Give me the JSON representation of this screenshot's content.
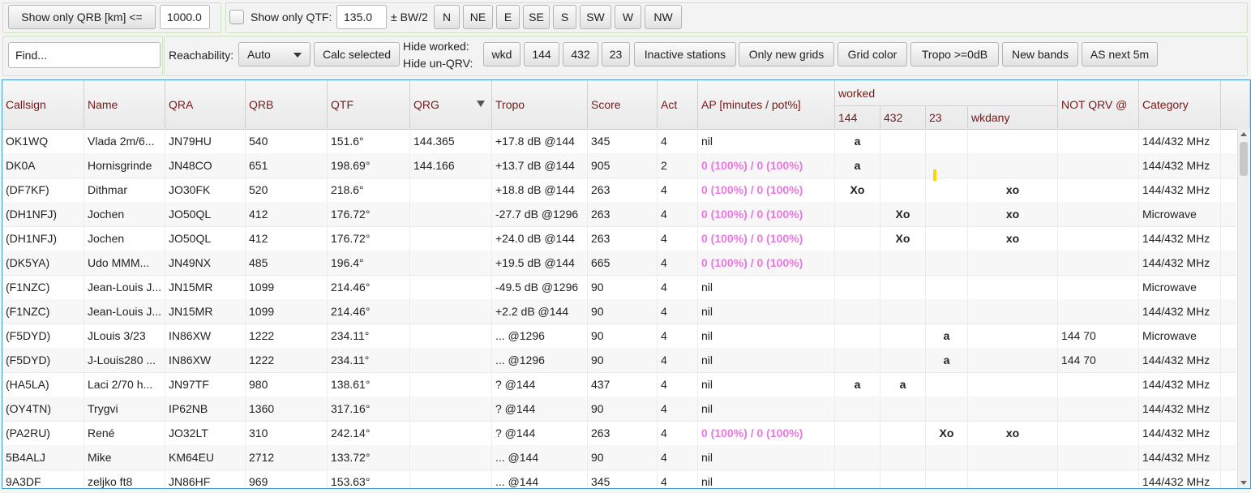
{
  "toolbar": {
    "qrb_button": "Show only QRB [km] <=",
    "qrb_value": "1000.0",
    "qtf_label": "Show only QTF:",
    "qtf_value": "135.0",
    "bw_label": "± BW/2",
    "directions": [
      "N",
      "NE",
      "E",
      "SE",
      "S",
      "SW",
      "W",
      "NW"
    ],
    "find_placeholder": "Find...",
    "reachability_label": "Reachability:",
    "reachability_value": "Auto",
    "calc_button": "Calc selected",
    "hide_worked": "Hide worked:",
    "hide_unqrv": "Hide un-QRV:",
    "filter_buttons": [
      "wkd",
      "144",
      "432",
      "23",
      "Inactive stations",
      "Only new grids",
      "Grid color",
      "Tropo >=0dB",
      "New bands",
      "AS next 5m"
    ]
  },
  "table": {
    "headers": {
      "callsign": "Callsign",
      "name": "Name",
      "qra": "QRA",
      "qrb": "QRB",
      "qtf": "QTF",
      "qrg": "QRG",
      "tropo": "Tropo",
      "score": "Score",
      "act": "Act",
      "ap": "AP [minutes / pot%]",
      "worked": "worked",
      "w144": "144",
      "w432": "432",
      "w23": "23",
      "wkdany": "wkdany",
      "notqrv": "NOT QRV @",
      "category": "Category"
    },
    "rows": [
      {
        "callsign": "OK1WQ",
        "name": "Vlada 2m/6...",
        "qra": "JN79HU",
        "qrb": "540",
        "qtf": "151.6°",
        "qrg": "144.365",
        "tropo": "+17.8 dB @144",
        "score": "345",
        "act": "4",
        "ap": "nil",
        "w144": "a",
        "w432": "",
        "w23": "",
        "wkdany": "",
        "notqrv": "",
        "category": "144/432 MHz"
      },
      {
        "callsign": "DK0A",
        "name": "Hornisgrinde",
        "qra": "JN48CO",
        "qrb": "651",
        "qtf": "198.69°",
        "qrg": "144.166",
        "tropo": "+13.7 dB @144",
        "score": "905",
        "act": "2",
        "ap": "0 (100%) / 0 (100%)",
        "w144": "a",
        "w432": "",
        "w23": "",
        "wkdany": "",
        "notqrv": "",
        "category": "144/432 MHz"
      },
      {
        "callsign": "(DF7KF)",
        "name": "Dithmar",
        "qra": "JO30FK",
        "qrb": "520",
        "qtf": "218.6°",
        "qrg": "",
        "tropo": "+18.8 dB @144",
        "score": "263",
        "act": "4",
        "ap": "0 (100%) / 0 (100%)",
        "w144": "Xo",
        "w432": "",
        "w23": "",
        "wkdany": "xo",
        "notqrv": "",
        "category": "144/432 MHz"
      },
      {
        "callsign": "(DH1NFJ)",
        "name": "Jochen",
        "qra": "JO50QL",
        "qrb": "412",
        "qtf": "176.72°",
        "qrg": "",
        "tropo": "-27.7 dB @1296",
        "score": "263",
        "act": "4",
        "ap": "0 (100%) / 0 (100%)",
        "w144": "",
        "w432": "Xo",
        "w23": "",
        "wkdany": "xo",
        "notqrv": "",
        "category": "Microwave"
      },
      {
        "callsign": "(DH1NFJ)",
        "name": "Jochen",
        "qra": "JO50QL",
        "qrb": "412",
        "qtf": "176.72°",
        "qrg": "",
        "tropo": "+24.0 dB @144",
        "score": "263",
        "act": "4",
        "ap": "0 (100%) / 0 (100%)",
        "w144": "",
        "w432": "Xo",
        "w23": "",
        "wkdany": "xo",
        "notqrv": "",
        "category": "144/432 MHz"
      },
      {
        "callsign": "(DK5YA)",
        "name": "Udo MMM...",
        "qra": "JN49NX",
        "qrb": "485",
        "qtf": "196.4°",
        "qrg": "",
        "tropo": "+19.5 dB @144",
        "score": "665",
        "act": "4",
        "ap": "0 (100%) / 0 (100%)",
        "w144": "",
        "w432": "",
        "w23": "",
        "wkdany": "",
        "notqrv": "",
        "category": "144/432 MHz"
      },
      {
        "callsign": "(F1NZC)",
        "name": "Jean-Louis J...",
        "qra": "JN15MR",
        "qrb": "1099",
        "qtf": "214.46°",
        "qrg": "",
        "tropo": "-49.5 dB @1296",
        "score": "90",
        "act": "4",
        "ap": "nil",
        "w144": "",
        "w432": "",
        "w23": "",
        "wkdany": "",
        "notqrv": "",
        "category": "Microwave"
      },
      {
        "callsign": "(F1NZC)",
        "name": "Jean-Louis J...",
        "qra": "JN15MR",
        "qrb": "1099",
        "qtf": "214.46°",
        "qrg": "",
        "tropo": "+2.2 dB @144",
        "score": "90",
        "act": "4",
        "ap": "nil",
        "w144": "",
        "w432": "",
        "w23": "",
        "wkdany": "",
        "notqrv": "",
        "category": "144/432 MHz"
      },
      {
        "callsign": "(F5DYD)",
        "name": "JLouis 3/23",
        "qra": "IN86XW",
        "qrb": "1222",
        "qtf": "234.11°",
        "qrg": "",
        "tropo": "... @1296",
        "score": "90",
        "act": "4",
        "ap": "nil",
        "w144": "",
        "w432": "",
        "w23": "a",
        "wkdany": "",
        "notqrv": "144 70",
        "category": "Microwave"
      },
      {
        "callsign": "(F5DYD)",
        "name": "J-Louis280 ...",
        "qra": "IN86XW",
        "qrb": "1222",
        "qtf": "234.11°",
        "qrg": "",
        "tropo": "... @1296",
        "score": "90",
        "act": "4",
        "ap": "nil",
        "w144": "",
        "w432": "",
        "w23": "a",
        "wkdany": "",
        "notqrv": "144 70",
        "category": "144/432 MHz"
      },
      {
        "callsign": "(HA5LA)",
        "name": "Laci 2/70 h...",
        "qra": "JN97TF",
        "qrb": "980",
        "qtf": "138.61°",
        "qrg": "",
        "tropo": "? @144",
        "score": "437",
        "act": "4",
        "ap": "nil",
        "w144": "a",
        "w432": "a",
        "w23": "",
        "wkdany": "",
        "notqrv": "",
        "category": "144/432 MHz"
      },
      {
        "callsign": "(OY4TN)",
        "name": "Trygvi",
        "qra": "IP62NB",
        "qrb": "1360",
        "qtf": "317.16°",
        "qrg": "",
        "tropo": "? @144",
        "score": "90",
        "act": "4",
        "ap": "nil",
        "w144": "",
        "w432": "",
        "w23": "",
        "wkdany": "",
        "notqrv": "",
        "category": "144/432 MHz"
      },
      {
        "callsign": "(PA2RU)",
        "name": "René",
        "qra": "JO32LT",
        "qrb": "310",
        "qtf": "242.14°",
        "qrg": "",
        "tropo": "? @144",
        "score": "263",
        "act": "4",
        "ap": "0 (100%) / 0 (100%)",
        "w144": "",
        "w432": "",
        "w23": "Xo",
        "wkdany": "xo",
        "notqrv": "",
        "category": "144/432 MHz"
      },
      {
        "callsign": "5B4ALJ",
        "name": "Mike",
        "qra": "KM64EU",
        "qrb": "2712",
        "qtf": "133.72°",
        "qrg": "",
        "tropo": "... @144",
        "score": "90",
        "act": "4",
        "ap": "nil",
        "w144": "",
        "w432": "",
        "w23": "",
        "wkdany": "",
        "notqrv": "",
        "category": "144/432 MHz"
      },
      {
        "callsign": "9A3DF",
        "name": "zeljko ft8",
        "qra": "JN86HF",
        "qrb": "969",
        "qtf": "153.63°",
        "qrg": "",
        "tropo": "... @144",
        "score": "345",
        "act": "4",
        "ap": "nil",
        "w144": "",
        "w432": "",
        "w23": "",
        "wkdany": "",
        "notqrv": "",
        "category": "144/432 MHz"
      }
    ]
  }
}
